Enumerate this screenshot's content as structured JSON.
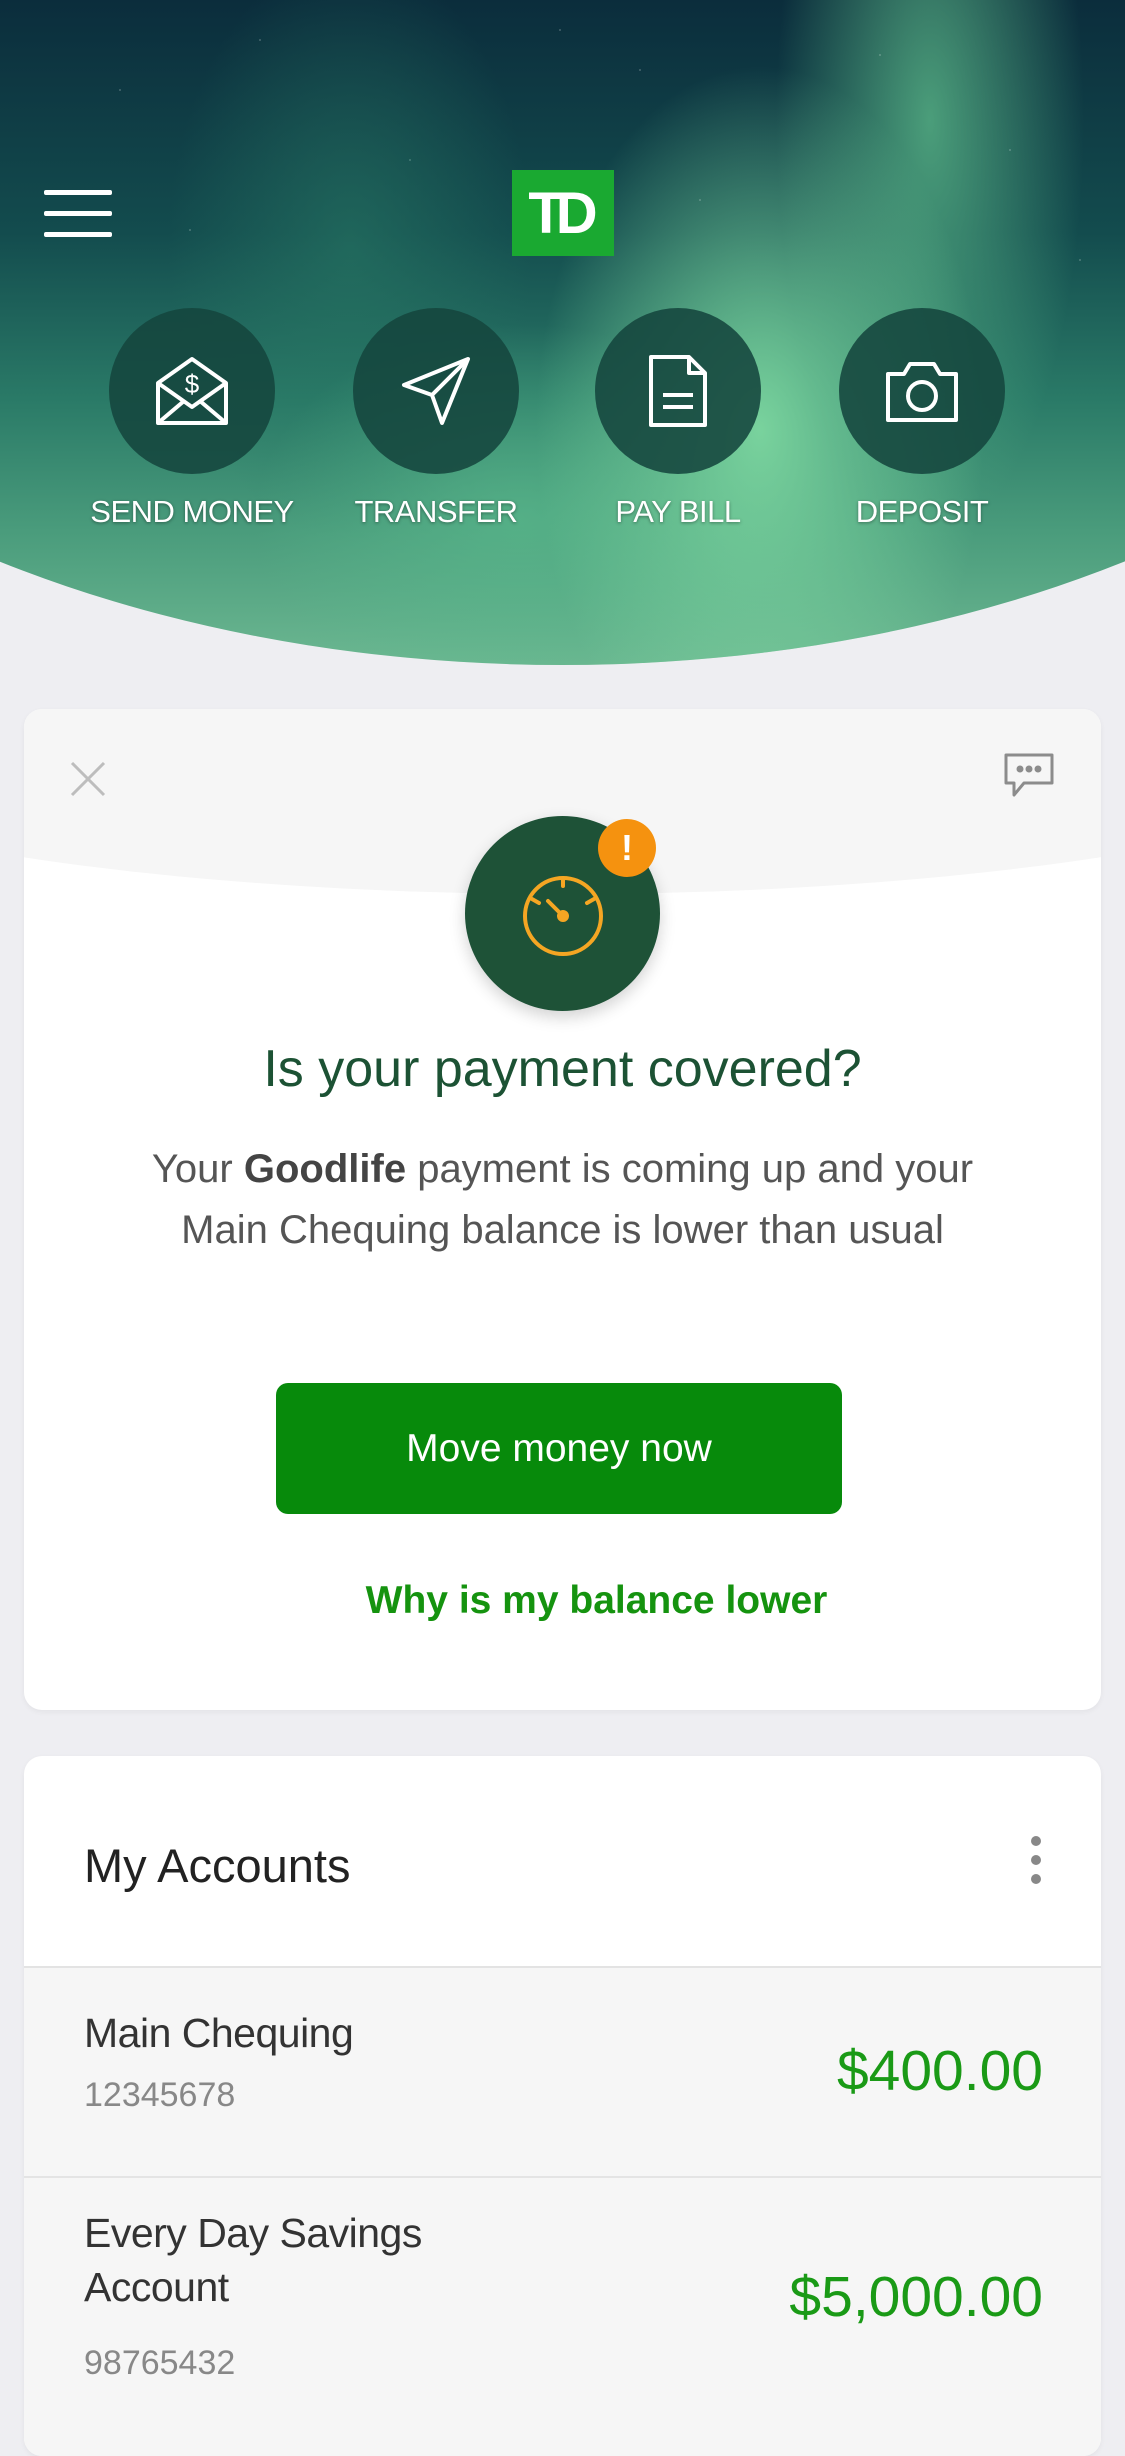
{
  "header": {
    "logo_text": "TD",
    "quick_actions": [
      {
        "label": "SEND MONEY",
        "icon": "envelope-dollar-icon"
      },
      {
        "label": "TRANSFER",
        "icon": "paper-plane-icon"
      },
      {
        "label": "PAY BILL",
        "icon": "document-icon"
      },
      {
        "label": "DEPOSIT",
        "icon": "camera-icon"
      }
    ]
  },
  "alert": {
    "title": "Is your payment covered?",
    "body_prefix": "Your ",
    "payee": "Goodlife",
    "body_suffix": " payment is coming up and your Main Chequing balance is lower than usual",
    "badge": "!",
    "primary_button": "Move money now",
    "secondary_link": "Why is my balance lower"
  },
  "accounts": {
    "title": "My Accounts",
    "items": [
      {
        "name": "Main Chequing",
        "number": "12345678",
        "balance": "$400.00"
      },
      {
        "name": "Every Day Savings Account",
        "number": "98765432",
        "balance": "$5,000.00"
      }
    ]
  },
  "colors": {
    "brand_green": "#1aa931",
    "button_green": "#078a0b",
    "balance_green": "#1a9a16",
    "alert_badge": "#f5920f",
    "gauge_bg": "#1e5237"
  }
}
